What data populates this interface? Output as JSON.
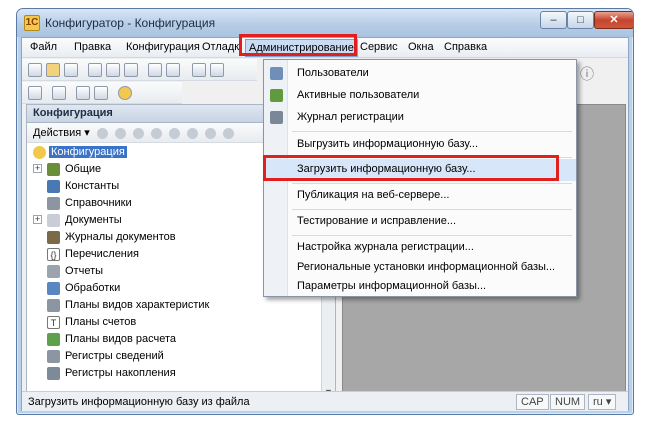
{
  "window": {
    "title": "Конфигуратор - Конфигурация",
    "app_icon": "1С"
  },
  "titlebar_buttons": {
    "minimize": "–",
    "maximize": "□",
    "close": "✕"
  },
  "menubar": {
    "items": [
      "Файл",
      "Правка",
      "Конфигурация",
      "Отладка",
      "Администрирование",
      "Сервис",
      "Окна",
      "Справка"
    ],
    "active": "Администрирование"
  },
  "panel": {
    "title": "Конфигурация",
    "actions_label": "Действия ▾"
  },
  "tree": [
    {
      "label": "Конфигурация",
      "icon": "circle-yellow-icon",
      "selected": true
    },
    {
      "label": "Общие",
      "icon": "general-icon",
      "expandable": true
    },
    {
      "label": "Константы",
      "icon": "constant-icon"
    },
    {
      "label": "Справочники",
      "icon": "catalog-icon"
    },
    {
      "label": "Документы",
      "icon": "document-icon",
      "expandable": true
    },
    {
      "label": "Журналы документов",
      "icon": "journal-icon"
    },
    {
      "label": "Перечисления",
      "icon": "enum-icon"
    },
    {
      "label": "Отчеты",
      "icon": "report-icon"
    },
    {
      "label": "Обработки",
      "icon": "processing-icon"
    },
    {
      "label": "Планы видов характеристик",
      "icon": "chart-types-icon"
    },
    {
      "label": "Планы счетов",
      "icon": "accounts-icon"
    },
    {
      "label": "Планы видов расчета",
      "icon": "calc-types-icon"
    },
    {
      "label": "Регистры сведений",
      "icon": "info-register-icon"
    },
    {
      "label": "Регистры накопления",
      "icon": "accum-register-icon"
    }
  ],
  "dropdown": {
    "items": [
      {
        "label": "Пользователи",
        "icon": "users-icon"
      },
      {
        "label": "Активные пользователи",
        "icon": "active-users-icon"
      },
      {
        "label": "Журнал регистрации",
        "icon": "log-icon"
      },
      {
        "label": "Выгрузить информационную базу...",
        "icon": ""
      },
      {
        "label": "Загрузить информационную базу...",
        "icon": "",
        "highlighted": true
      },
      {
        "label": "Публикация на веб-сервере...",
        "icon": ""
      },
      {
        "label": "Тестирование и исправление...",
        "icon": ""
      },
      {
        "label": "Настройка журнала регистрации...",
        "icon": ""
      },
      {
        "label": "Региональные установки информационной базы...",
        "icon": ""
      },
      {
        "label": "Параметры информационной базы...",
        "icon": ""
      }
    ]
  },
  "statusbar": {
    "text": "Загрузить информационную базу из файла",
    "cap": "CAP",
    "num": "NUM",
    "lang": "ru ▾"
  },
  "colors": {
    "highlight_border": "#e0201f",
    "selection": "#3b73c7"
  }
}
